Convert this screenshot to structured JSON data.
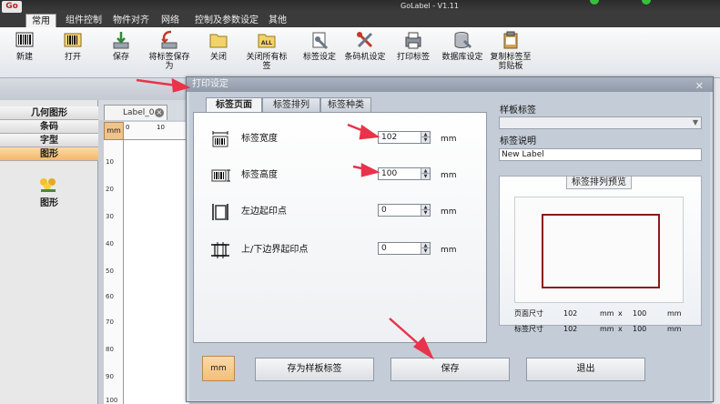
{
  "app": {
    "logo_text": "Go",
    "title": "GoLabel - V1.11"
  },
  "menu_tabs": [
    "常用",
    "组件控制",
    "物件对齐",
    "网络",
    "控制及参数设定",
    "其他"
  ],
  "ribbon": [
    {
      "label": "新建",
      "icon": "barcode-new-icon"
    },
    {
      "label": "打开",
      "icon": "barcode-open-icon"
    },
    {
      "label": "保存",
      "icon": "save-icon"
    },
    {
      "label": "将标签保存为",
      "icon": "save-as-icon"
    },
    {
      "label": "关闭",
      "icon": "folder-close-icon"
    },
    {
      "label": "关闭所有标签",
      "icon": "folder-all-icon"
    },
    {
      "label": "标签设定",
      "icon": "label-settings-icon"
    },
    {
      "label": "条码机设定",
      "icon": "printer-settings-icon"
    },
    {
      "label": "打印标签",
      "icon": "print-icon"
    },
    {
      "label": "数据库设定",
      "icon": "database-icon"
    },
    {
      "label": "复制标签至剪贴板",
      "icon": "clipboard-icon"
    }
  ],
  "left_panel": {
    "items": [
      "几何图形",
      "条码",
      "字型",
      "图形"
    ],
    "active_item": "图形",
    "graphic_label": "图形"
  },
  "document": {
    "tab_label": "Label_0",
    "ruler_unit": "mm",
    "ruler_top_marks": [
      "0",
      "10"
    ],
    "ruler_left_marks": [
      "10",
      "20",
      "30",
      "40",
      "50",
      "60",
      "70",
      "80",
      "90",
      "100"
    ]
  },
  "dialog": {
    "title": "打印设定",
    "tabs": [
      "标签页面",
      "标签排列",
      "标签种类"
    ],
    "active_tab": "标签页面",
    "fields": [
      {
        "label": "标签宽度",
        "value": "102",
        "unit": "mm",
        "icon": "label-width-icon"
      },
      {
        "label": "标签高度",
        "value": "100",
        "unit": "mm",
        "icon": "label-height-icon"
      },
      {
        "label": "左边起印点",
        "value": "0",
        "unit": "mm",
        "icon": "left-offset-icon"
      },
      {
        "label": "上/下边界起印点",
        "value": "0",
        "unit": "mm",
        "icon": "top-offset-icon"
      }
    ],
    "template_label": "样板标签",
    "template_value": "",
    "description_label": "标签说明",
    "description_value": "New Label",
    "preview_title": "标签排列预览",
    "page_size": {
      "label": "页面尺寸",
      "w": "102",
      "unit_w": "mm",
      "x": "x",
      "h": "100",
      "unit_h": "mm"
    },
    "label_size": {
      "label": "标签尺寸",
      "w": "102",
      "unit_w": "mm",
      "x": "x",
      "h": "100",
      "unit_h": "mm"
    },
    "buttons": {
      "unit": "mm",
      "save_template": "存为样板标签",
      "save": "保存",
      "exit": "退出"
    }
  },
  "colors": {
    "annotation_arrow": "#e8334a",
    "preview_rect": "#8b1a1a",
    "active_orange": "#f4b86a"
  }
}
